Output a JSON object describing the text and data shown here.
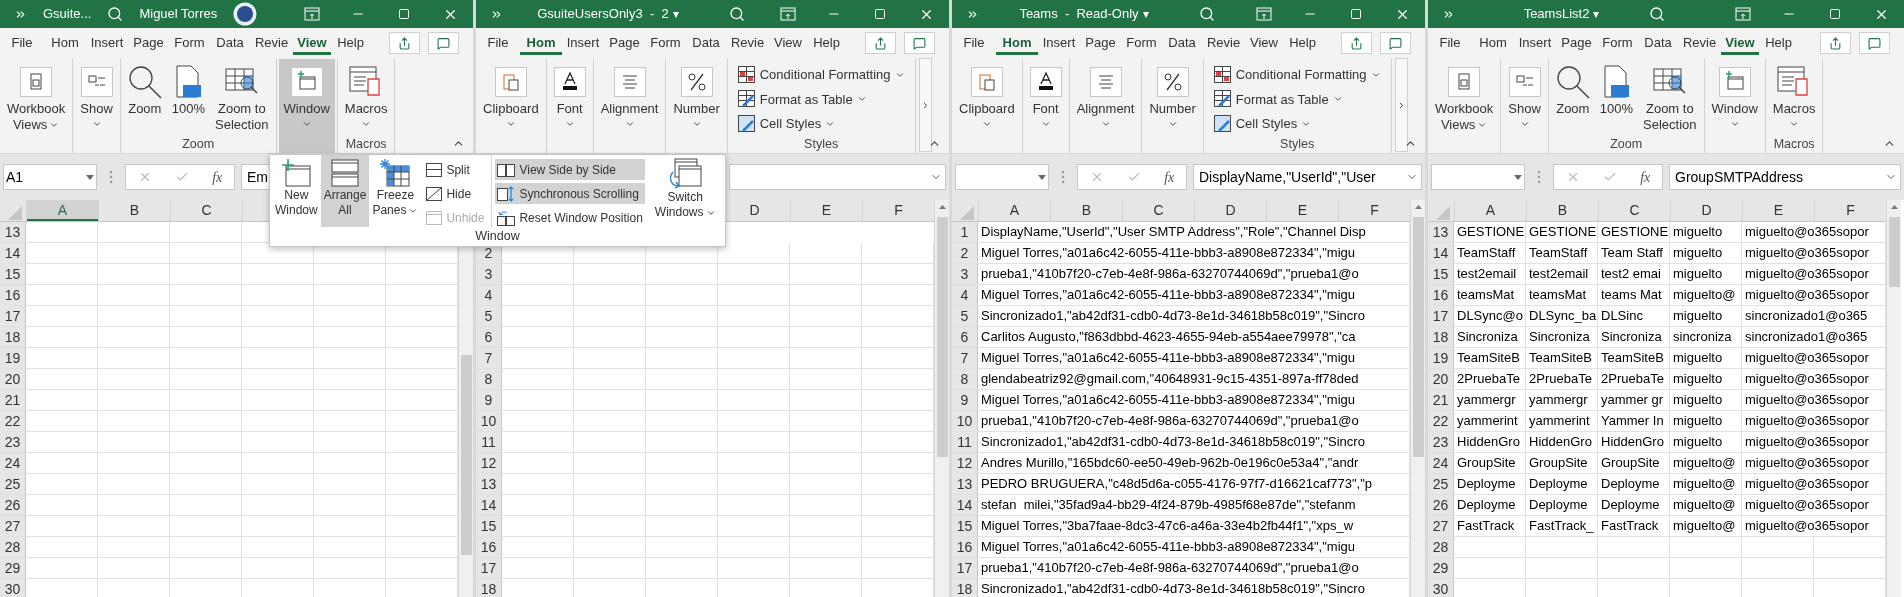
{
  "windows": [
    {
      "title": "Gsuite...",
      "user": "Miguel Torres",
      "tabs": [
        {
          "label": "File",
          "selected": false
        },
        {
          "label": "Hom",
          "selected": false
        },
        {
          "label": "Insert",
          "selected": false
        },
        {
          "label": "Page",
          "selected": false
        },
        {
          "label": "Form",
          "selected": false
        },
        {
          "label": "Data",
          "selected": false
        },
        {
          "label": "Revie",
          "selected": false
        },
        {
          "label": "View",
          "selected": true
        },
        {
          "label": "Help",
          "selected": false
        }
      ],
      "ribbon": {
        "kind": "view",
        "groups": [
          {
            "buttons": [
              {
                "lines": [
                  "Workbook",
                  "Views"
                ],
                "kind": "inline",
                "pressed": false
              }
            ]
          },
          {
            "buttons": [
              {
                "lines": [
                  "Show"
                ],
                "kind": "below",
                "pressed": false
              }
            ]
          },
          {
            "label": "Zoom",
            "buttons": [
              {
                "lines": [
                  "Zoom"
                ],
                "pressed": false
              },
              {
                "lines": [
                  "100%"
                ],
                "pressed": false
              },
              {
                "lines": [
                  "Zoom to",
                  "Selection"
                ],
                "pressed": false
              }
            ]
          },
          {
            "buttons": [
              {
                "lines": [
                  "Window"
                ],
                "kind": "below",
                "pressed": true
              }
            ]
          },
          {
            "label": "Macros",
            "buttons": [
              {
                "lines": [
                  "Macros"
                ],
                "kind": "below",
                "pressed": false
              }
            ]
          }
        ]
      },
      "name_box": "A1",
      "function_label": "fx",
      "formula": "Em",
      "columns": [
        {
          "label": "A",
          "selected": true
        },
        {
          "label": "B",
          "selected": false
        },
        {
          "label": "C",
          "selected": false
        }
      ],
      "rows": [
        {
          "number": "13"
        },
        {
          "number": "14"
        },
        {
          "number": "15"
        },
        {
          "number": "16"
        },
        {
          "number": "17"
        },
        {
          "number": "18"
        },
        {
          "number": "19"
        },
        {
          "number": "20"
        },
        {
          "number": "21"
        },
        {
          "number": "22"
        },
        {
          "number": "23"
        },
        {
          "number": "24"
        },
        {
          "number": "25"
        },
        {
          "number": "26"
        },
        {
          "number": "27"
        },
        {
          "number": "28"
        },
        {
          "number": "29"
        },
        {
          "number": "30"
        }
      ]
    },
    {
      "title": "GsuiteUsersOnly3  -  2",
      "title_caret": "▾",
      "tabs": [
        {
          "label": "File",
          "selected": false
        },
        {
          "label": "Hom",
          "selected": true
        },
        {
          "label": "Insert",
          "selected": false
        },
        {
          "label": "Page",
          "selected": false
        },
        {
          "label": "Form",
          "selected": false
        },
        {
          "label": "Data",
          "selected": false
        },
        {
          "label": "Revie",
          "selected": false
        },
        {
          "label": "View",
          "selected": false
        },
        {
          "label": "Help",
          "selected": false
        }
      ],
      "ribbon": {
        "kind": "home",
        "groups": [
          {
            "buttons": [
              {
                "lines": [
                  "Clipboard"
                ],
                "kind": "below"
              }
            ]
          },
          {
            "buttons": [
              {
                "lines": [
                  "Font"
                ],
                "kind": "below"
              }
            ]
          },
          {
            "buttons": [
              {
                "lines": [
                  "Alignment"
                ],
                "kind": "below"
              }
            ]
          },
          {
            "buttons": [
              {
                "lines": [
                  "Number"
                ],
                "kind": "below"
              }
            ]
          },
          {
            "label": "Styles",
            "kind": "small",
            "buttons": [
              {
                "lines": [
                  "Conditional Formatting"
                ],
                "kind": "inline"
              },
              {
                "lines": [
                  "Format as Table"
                ],
                "kind": "inline"
              },
              {
                "lines": [
                  "Cell Styles"
                ],
                "kind": "inline"
              }
            ]
          }
        ]
      },
      "left_columns_covered": true,
      "first_row_covered": true,
      "columns": [
        {
          "label": "D",
          "selected": false
        },
        {
          "label": "E",
          "selected": false
        },
        {
          "label": "F",
          "selected": false
        }
      ],
      "rows": [
        {
          "number": "2"
        },
        {
          "number": "3"
        },
        {
          "number": "4"
        },
        {
          "number": "5"
        },
        {
          "number": "6"
        },
        {
          "number": "7"
        },
        {
          "number": "8"
        },
        {
          "number": "9"
        },
        {
          "number": "10"
        },
        {
          "number": "11"
        },
        {
          "number": "12"
        },
        {
          "number": "13"
        },
        {
          "number": "14"
        },
        {
          "number": "15"
        },
        {
          "number": "16"
        },
        {
          "number": "17"
        },
        {
          "number": "18"
        }
      ]
    },
    {
      "title": "Teams  -  Read-Only",
      "title_caret": "▾",
      "tabs": [
        {
          "label": "File",
          "selected": false
        },
        {
          "label": "Hom",
          "selected": true
        },
        {
          "label": "Insert",
          "selected": false
        },
        {
          "label": "Page",
          "selected": false
        },
        {
          "label": "Form",
          "selected": false
        },
        {
          "label": "Data",
          "selected": false
        },
        {
          "label": "Revie",
          "selected": false
        },
        {
          "label": "View",
          "selected": false
        },
        {
          "label": "Help",
          "selected": false
        }
      ],
      "ribbon": {
        "kind": "home",
        "groups": [
          {
            "buttons": [
              {
                "lines": [
                  "Clipboard"
                ],
                "kind": "below"
              }
            ]
          },
          {
            "buttons": [
              {
                "lines": [
                  "Font"
                ],
                "kind": "below"
              }
            ]
          },
          {
            "buttons": [
              {
                "lines": [
                  "Alignment"
                ],
                "kind": "below"
              }
            ]
          },
          {
            "buttons": [
              {
                "lines": [
                  "Number"
                ],
                "kind": "below"
              }
            ]
          },
          {
            "label": "Styles",
            "kind": "small",
            "buttons": [
              {
                "lines": [
                  "Conditional Formatting"
                ],
                "kind": "inline"
              },
              {
                "lines": [
                  "Format as Table"
                ],
                "kind": "inline"
              },
              {
                "lines": [
                  "Cell Styles"
                ],
                "kind": "inline"
              }
            ]
          }
        ]
      },
      "function_label": "fx",
      "formula": "DisplayName,\"UserId\",\"User",
      "columns": [
        {
          "label": "A",
          "selected": false
        },
        {
          "label": "B",
          "selected": false
        },
        {
          "label": "C",
          "selected": false
        },
        {
          "label": "D",
          "selected": false
        },
        {
          "label": "E",
          "selected": false
        },
        {
          "label": "F",
          "selected": false
        }
      ],
      "rows": [
        {
          "number": "1",
          "cells": [
            "DisplayName,\"UserId\",\"User SMTP Address\",\"Role\",\"Channel Disp"
          ]
        },
        {
          "number": "2",
          "cells": [
            "Miguel Torres,\"a01a6c42-6055-411e-bbb3-a8908e872334\",\"migu"
          ]
        },
        {
          "number": "3",
          "cells": [
            "prueba1,\"410b7f20-c7eb-4e8f-986a-63270744069d\",\"prueba1@o"
          ]
        },
        {
          "number": "4",
          "cells": [
            "Miguel Torres,\"a01a6c42-6055-411e-bbb3-a8908e872334\",\"migu"
          ]
        },
        {
          "number": "5",
          "cells": [
            "Sincronizado1,\"ab42df31-cdb0-4d73-8e1d-34618b58c019\",\"Sincro"
          ]
        },
        {
          "number": "6",
          "cells": [
            "Carlitos Augusto,\"f863dbbd-4623-4655-94eb-a554aee79978\",\"ca"
          ]
        },
        {
          "number": "7",
          "cells": [
            "Miguel Torres,\"a01a6c42-6055-411e-bbb3-a8908e872334\",\"migu"
          ]
        },
        {
          "number": "8",
          "cells": [
            "glendabeatriz92@gmail.com,\"40648931-9c15-4351-897a-ff78ded"
          ]
        },
        {
          "number": "9",
          "cells": [
            "Miguel Torres,\"a01a6c42-6055-411e-bbb3-a8908e872334\",\"migu"
          ]
        },
        {
          "number": "10",
          "cells": [
            "prueba1,\"410b7f20-c7eb-4e8f-986a-63270744069d\",\"prueba1@o"
          ]
        },
        {
          "number": "11",
          "cells": [
            "Sincronizado1,\"ab42df31-cdb0-4d73-8e1d-34618b58c019\",\"Sincro"
          ]
        },
        {
          "number": "12",
          "cells": [
            "Andres Murillo,\"165bdc60-ee50-49eb-962b-0e196c0e53a4\",\"andr"
          ]
        },
        {
          "number": "13",
          "cells": [
            "PEDRO BRUGUERA,\"c48d5d6a-c055-4176-97f7-d16621caf773\",\"p"
          ]
        },
        {
          "number": "14",
          "cells": [
            "stefan  milei,\"35fad9a4-bb29-4f24-879b-4985f68e87de\",\"stefanm"
          ]
        },
        {
          "number": "15",
          "cells": [
            "Miguel Torres,\"3ba7faae-8dc3-47c6-a46a-33e4b2fb44f1\",\"xps_w"
          ]
        },
        {
          "number": "16",
          "cells": [
            "Miguel Torres,\"a01a6c42-6055-411e-bbb3-a8908e872334\",\"migu"
          ]
        },
        {
          "number": "17",
          "cells": [
            "prueba1,\"410b7f20-c7eb-4e8f-986a-63270744069d\",\"prueba1@o"
          ]
        },
        {
          "number": "18",
          "cells": [
            "Sincronizado1,\"ab42df31-cdb0-4d73-8e1d-34618b58c019\",\"Sincro"
          ]
        }
      ]
    },
    {
      "title": "TeamsList2",
      "title_caret": "▾",
      "tabs": [
        {
          "label": "File",
          "selected": false
        },
        {
          "label": "Hom",
          "selected": false
        },
        {
          "label": "Insert",
          "selected": false
        },
        {
          "label": "Page",
          "selected": false
        },
        {
          "label": "Form",
          "selected": false
        },
        {
          "label": "Data",
          "selected": false
        },
        {
          "label": "Revie",
          "selected": false
        },
        {
          "label": "View",
          "selected": true
        },
        {
          "label": "Help",
          "selected": false
        }
      ],
      "ribbon": {
        "kind": "view",
        "groups": [
          {
            "buttons": [
              {
                "lines": [
                  "Workbook",
                  "Views"
                ],
                "kind": "inline",
                "pressed": false
              }
            ]
          },
          {
            "buttons": [
              {
                "lines": [
                  "Show"
                ],
                "kind": "below",
                "pressed": false
              }
            ]
          },
          {
            "label": "Zoom",
            "buttons": [
              {
                "lines": [
                  "Zoom"
                ],
                "pressed": false
              },
              {
                "lines": [
                  "100%"
                ],
                "pressed": false
              },
              {
                "lines": [
                  "Zoom to",
                  "Selection"
                ],
                "pressed": false
              }
            ]
          },
          {
            "buttons": [
              {
                "lines": [
                  "Window"
                ],
                "kind": "below",
                "pressed": false
              }
            ]
          },
          {
            "label": "Macros",
            "buttons": [
              {
                "lines": [
                  "Macros"
                ],
                "kind": "below",
                "pressed": false
              }
            ]
          }
        ]
      },
      "function_label": "fx",
      "formula": "GroupSMTPAddress",
      "columns": [
        {
          "label": "A",
          "selected": false
        },
        {
          "label": "B",
          "selected": false
        },
        {
          "label": "C",
          "selected": false
        },
        {
          "label": "D",
          "selected": false
        },
        {
          "label": "E",
          "selected": false
        },
        {
          "label": "F",
          "selected": false
        }
      ],
      "rows": [
        {
          "number": "13",
          "cells": [
            "GESTIONE",
            "GESTIONE",
            "GESTIONE",
            "miguelto",
            "miguelto@o365sopor"
          ]
        },
        {
          "number": "14",
          "cells": [
            "TeamStaff",
            "TeamStaff",
            "Team Staff",
            "miguelto",
            "miguelto@o365sopor"
          ]
        },
        {
          "number": "15",
          "cells": [
            "test2email",
            "test2email",
            "test2 emai",
            "miguelto",
            "miguelto@o365sopor"
          ]
        },
        {
          "number": "16",
          "cells": [
            "teamsMat",
            "teamsMat",
            "teams Mat",
            "miguelto@",
            "miguelto@o365sopor"
          ]
        },
        {
          "number": "17",
          "cells": [
            "DLSync@o",
            "DLSync_ba",
            "DLSinc",
            "miguelto",
            "sincronizado1@o365"
          ]
        },
        {
          "number": "18",
          "cells": [
            "Sincroniza",
            "Sincroniza",
            "Sincroniza",
            "sincroniza",
            "sincronizado1@o365"
          ]
        },
        {
          "number": "19",
          "cells": [
            "TeamSiteB",
            "TeamSiteB",
            "TeamSiteB",
            "miguelto",
            "miguelto@o365sopor"
          ]
        },
        {
          "number": "20",
          "cells": [
            "2PruebaTe",
            "2PruebaTe",
            "2PruebaTe",
            "miguelto",
            "miguelto@o365sopor"
          ]
        },
        {
          "number": "21",
          "cells": [
            "yammergr",
            "yammergr",
            "yammer gr",
            "miguelto",
            "miguelto@o365sopor"
          ]
        },
        {
          "number": "22",
          "cells": [
            "yammerint",
            "yammerint",
            "Yammer In",
            "miguelto",
            "miguelto@o365sopor"
          ]
        },
        {
          "number": "23",
          "cells": [
            "HiddenGro",
            "HiddenGro",
            "HiddenGro",
            "miguelto",
            "miguelto@o365sopor"
          ]
        },
        {
          "number": "24",
          "cells": [
            "GroupSite",
            "GroupSite",
            "GroupSite",
            "miguelto@",
            "miguelto@o365sopor"
          ]
        },
        {
          "number": "25",
          "cells": [
            "Deployme",
            "Deployme",
            "Deployme",
            "miguelto@",
            "miguelto@o365sopor"
          ]
        },
        {
          "number": "26",
          "cells": [
            "Deployme",
            "Deployme",
            "Deployme",
            "miguelto@",
            "miguelto@o365sopor"
          ]
        },
        {
          "number": "27",
          "cells": [
            "FastTrack",
            "FastTrack_",
            "FastTrack",
            "miguelto@",
            "miguelto@o365sopor"
          ]
        },
        {
          "number": "28"
        },
        {
          "number": "29"
        },
        {
          "number": "30"
        }
      ]
    }
  ],
  "window_menu": {
    "label": "Window",
    "items": [
      {
        "kind": "large",
        "lines": [
          "New",
          "Window"
        ],
        "highlighted": false,
        "disabled": false
      },
      {
        "kind": "large",
        "lines": [
          "Arrange",
          "All"
        ],
        "highlighted": true,
        "disabled": false
      },
      {
        "kind": "large-menu",
        "lines": [
          "Freeze",
          "Panes"
        ],
        "highlighted": false,
        "disabled": false
      },
      {
        "kind": "small",
        "lines": [
          "Split"
        ],
        "highlighted": false,
        "disabled": false
      },
      {
        "kind": "small",
        "lines": [
          "Hide"
        ],
        "highlighted": false,
        "disabled": false
      },
      {
        "kind": "small",
        "lines": [
          "Unhide"
        ],
        "highlighted": false,
        "disabled": true
      },
      {
        "kind": "small",
        "lines": [
          "View Side by Side"
        ],
        "highlighted": true,
        "disabled": false
      },
      {
        "kind": "small",
        "lines": [
          "Synchronous Scrolling"
        ],
        "highlighted": true,
        "disabled": false
      },
      {
        "kind": "small",
        "lines": [
          "Reset Window Position"
        ],
        "highlighted": false,
        "disabled": false
      },
      {
        "kind": "large-menu",
        "lines": [
          "Switch",
          "Windows"
        ],
        "highlighted": false,
        "disabled": false
      }
    ]
  }
}
